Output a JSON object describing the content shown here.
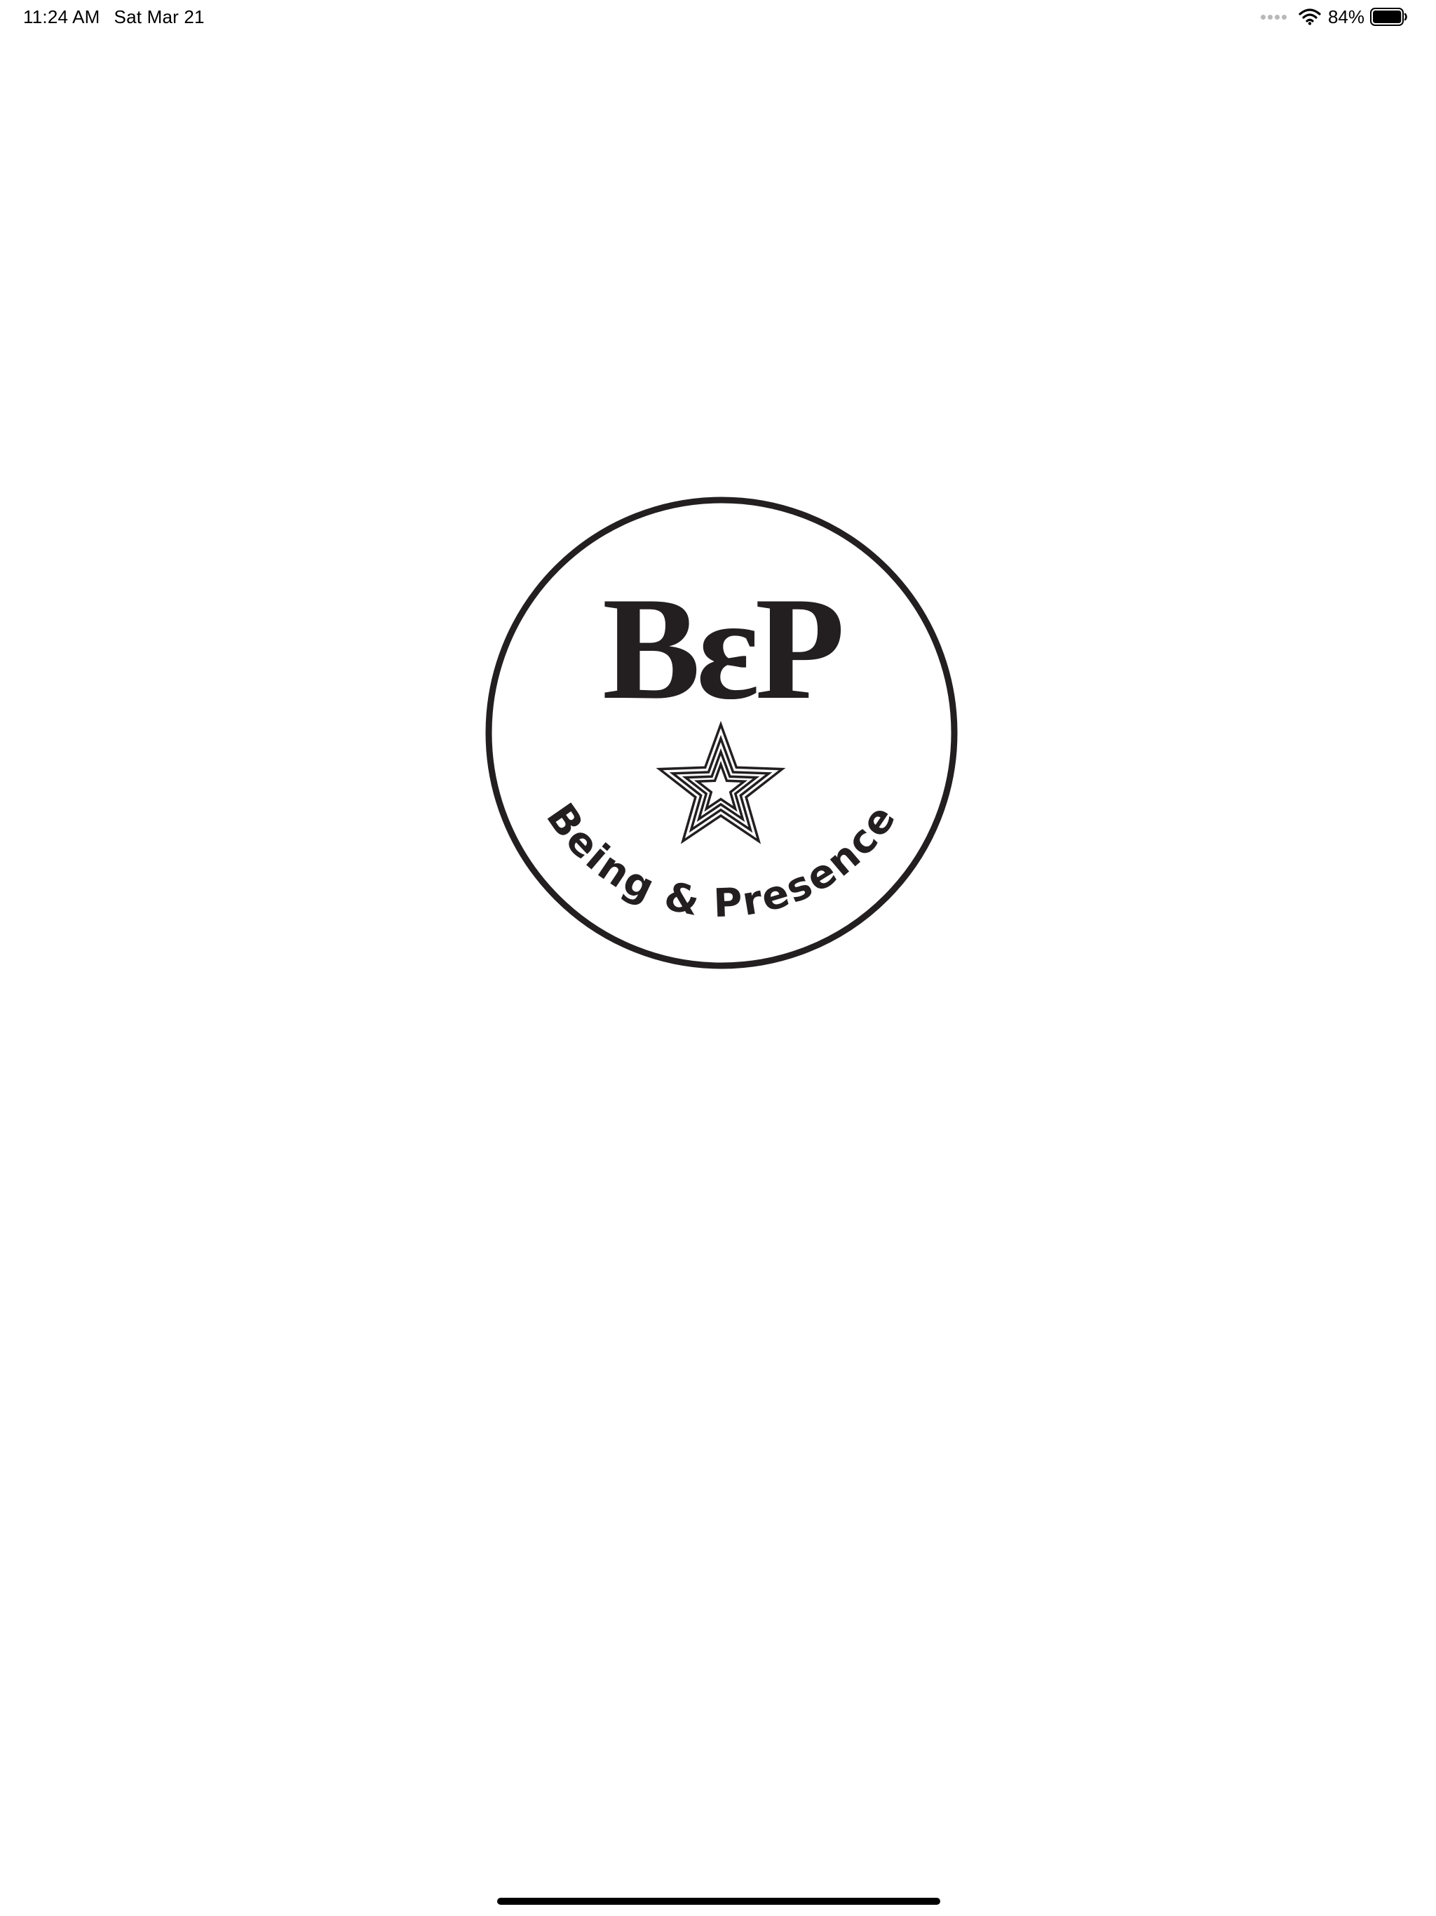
{
  "status_bar": {
    "time": "11:24 AM",
    "date": "Sat Mar 21",
    "battery_percent": "84%",
    "battery_level": 0.84,
    "icons": [
      "signal-dots-icon",
      "wifi-icon",
      "battery-icon"
    ]
  },
  "logo": {
    "monogram": "BεP",
    "tagline": "Being & Presence",
    "icon": "concentric-star-icon",
    "color": "#231f20"
  },
  "colors": {
    "background": "#ffffff",
    "foreground": "#000000",
    "signal_inactive": "#b8b8b8"
  }
}
